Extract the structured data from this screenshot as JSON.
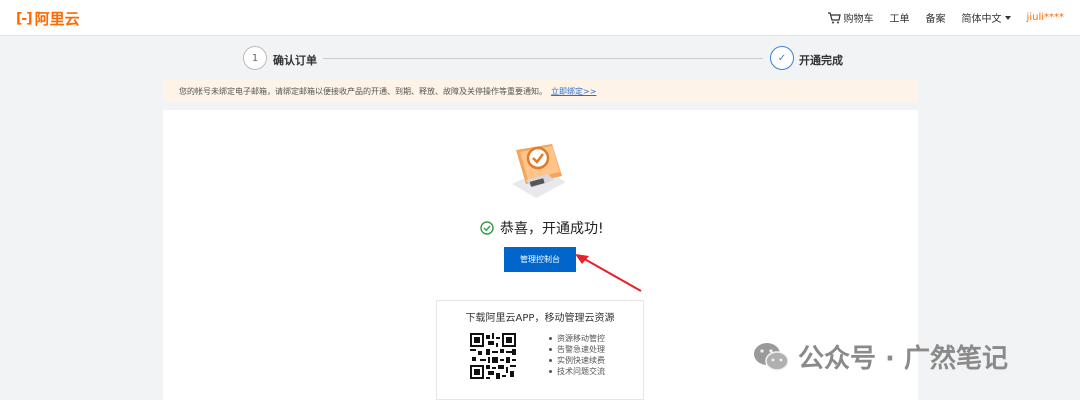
{
  "header": {
    "logo_text": "阿里云",
    "logo_mark": "[-]",
    "cart_label": "购物车",
    "ticket_label": "工单",
    "filing_label": "备案",
    "language_label": "简体中文",
    "user_label": "jiuli****"
  },
  "steps": [
    {
      "number": "1",
      "label": "确认订单"
    },
    {
      "number": "✓",
      "label": "开通完成"
    }
  ],
  "notice": {
    "text": "您的帐号未绑定电子邮箱，请绑定邮箱以便接收产品的开通、到期、释放、故障及关停操作等重要通知。",
    "link": "立即绑定>>"
  },
  "result": {
    "message": "恭喜，开通成功!",
    "button": "管理控制台"
  },
  "app": {
    "title": "下载阿里云APP，移动管理云资源",
    "features": [
      "资源移动管控",
      "告警急速处理",
      "实例快速续费",
      "技术问题交流"
    ]
  },
  "watermark": "公众号 · 广然笔记",
  "colors": {
    "brand": "#ff6a00",
    "primary": "#0066cc",
    "success": "#2f9e44",
    "notice_bg": "#fdf3e6",
    "arrow": "#e8202c"
  }
}
